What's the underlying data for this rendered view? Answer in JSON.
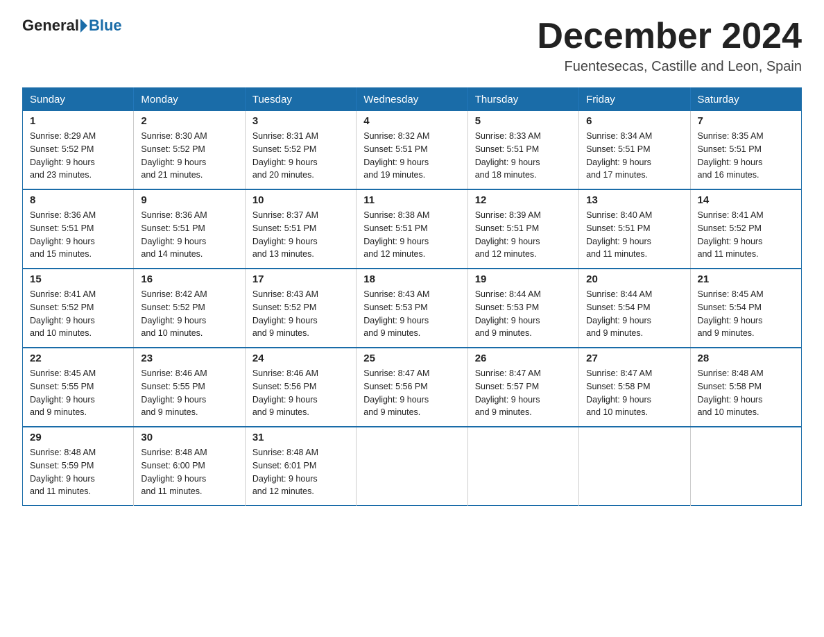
{
  "logo": {
    "general": "General",
    "blue": "Blue"
  },
  "title": {
    "month_year": "December 2024",
    "location": "Fuentesecas, Castille and Leon, Spain"
  },
  "weekdays": [
    "Sunday",
    "Monday",
    "Tuesday",
    "Wednesday",
    "Thursday",
    "Friday",
    "Saturday"
  ],
  "weeks": [
    [
      {
        "day": "1",
        "sunrise": "8:29 AM",
        "sunset": "5:52 PM",
        "daylight": "9 hours and 23 minutes."
      },
      {
        "day": "2",
        "sunrise": "8:30 AM",
        "sunset": "5:52 PM",
        "daylight": "9 hours and 21 minutes."
      },
      {
        "day": "3",
        "sunrise": "8:31 AM",
        "sunset": "5:52 PM",
        "daylight": "9 hours and 20 minutes."
      },
      {
        "day": "4",
        "sunrise": "8:32 AM",
        "sunset": "5:51 PM",
        "daylight": "9 hours and 19 minutes."
      },
      {
        "day": "5",
        "sunrise": "8:33 AM",
        "sunset": "5:51 PM",
        "daylight": "9 hours and 18 minutes."
      },
      {
        "day": "6",
        "sunrise": "8:34 AM",
        "sunset": "5:51 PM",
        "daylight": "9 hours and 17 minutes."
      },
      {
        "day": "7",
        "sunrise": "8:35 AM",
        "sunset": "5:51 PM",
        "daylight": "9 hours and 16 minutes."
      }
    ],
    [
      {
        "day": "8",
        "sunrise": "8:36 AM",
        "sunset": "5:51 PM",
        "daylight": "9 hours and 15 minutes."
      },
      {
        "day": "9",
        "sunrise": "8:36 AM",
        "sunset": "5:51 PM",
        "daylight": "9 hours and 14 minutes."
      },
      {
        "day": "10",
        "sunrise": "8:37 AM",
        "sunset": "5:51 PM",
        "daylight": "9 hours and 13 minutes."
      },
      {
        "day": "11",
        "sunrise": "8:38 AM",
        "sunset": "5:51 PM",
        "daylight": "9 hours and 12 minutes."
      },
      {
        "day": "12",
        "sunrise": "8:39 AM",
        "sunset": "5:51 PM",
        "daylight": "9 hours and 12 minutes."
      },
      {
        "day": "13",
        "sunrise": "8:40 AM",
        "sunset": "5:51 PM",
        "daylight": "9 hours and 11 minutes."
      },
      {
        "day": "14",
        "sunrise": "8:41 AM",
        "sunset": "5:52 PM",
        "daylight": "9 hours and 11 minutes."
      }
    ],
    [
      {
        "day": "15",
        "sunrise": "8:41 AM",
        "sunset": "5:52 PM",
        "daylight": "9 hours and 10 minutes."
      },
      {
        "day": "16",
        "sunrise": "8:42 AM",
        "sunset": "5:52 PM",
        "daylight": "9 hours and 10 minutes."
      },
      {
        "day": "17",
        "sunrise": "8:43 AM",
        "sunset": "5:52 PM",
        "daylight": "9 hours and 9 minutes."
      },
      {
        "day": "18",
        "sunrise": "8:43 AM",
        "sunset": "5:53 PM",
        "daylight": "9 hours and 9 minutes."
      },
      {
        "day": "19",
        "sunrise": "8:44 AM",
        "sunset": "5:53 PM",
        "daylight": "9 hours and 9 minutes."
      },
      {
        "day": "20",
        "sunrise": "8:44 AM",
        "sunset": "5:54 PM",
        "daylight": "9 hours and 9 minutes."
      },
      {
        "day": "21",
        "sunrise": "8:45 AM",
        "sunset": "5:54 PM",
        "daylight": "9 hours and 9 minutes."
      }
    ],
    [
      {
        "day": "22",
        "sunrise": "8:45 AM",
        "sunset": "5:55 PM",
        "daylight": "9 hours and 9 minutes."
      },
      {
        "day": "23",
        "sunrise": "8:46 AM",
        "sunset": "5:55 PM",
        "daylight": "9 hours and 9 minutes."
      },
      {
        "day": "24",
        "sunrise": "8:46 AM",
        "sunset": "5:56 PM",
        "daylight": "9 hours and 9 minutes."
      },
      {
        "day": "25",
        "sunrise": "8:47 AM",
        "sunset": "5:56 PM",
        "daylight": "9 hours and 9 minutes."
      },
      {
        "day": "26",
        "sunrise": "8:47 AM",
        "sunset": "5:57 PM",
        "daylight": "9 hours and 9 minutes."
      },
      {
        "day": "27",
        "sunrise": "8:47 AM",
        "sunset": "5:58 PM",
        "daylight": "9 hours and 10 minutes."
      },
      {
        "day": "28",
        "sunrise": "8:48 AM",
        "sunset": "5:58 PM",
        "daylight": "9 hours and 10 minutes."
      }
    ],
    [
      {
        "day": "29",
        "sunrise": "8:48 AM",
        "sunset": "5:59 PM",
        "daylight": "9 hours and 11 minutes."
      },
      {
        "day": "30",
        "sunrise": "8:48 AM",
        "sunset": "6:00 PM",
        "daylight": "9 hours and 11 minutes."
      },
      {
        "day": "31",
        "sunrise": "8:48 AM",
        "sunset": "6:01 PM",
        "daylight": "9 hours and 12 minutes."
      },
      null,
      null,
      null,
      null
    ]
  ]
}
